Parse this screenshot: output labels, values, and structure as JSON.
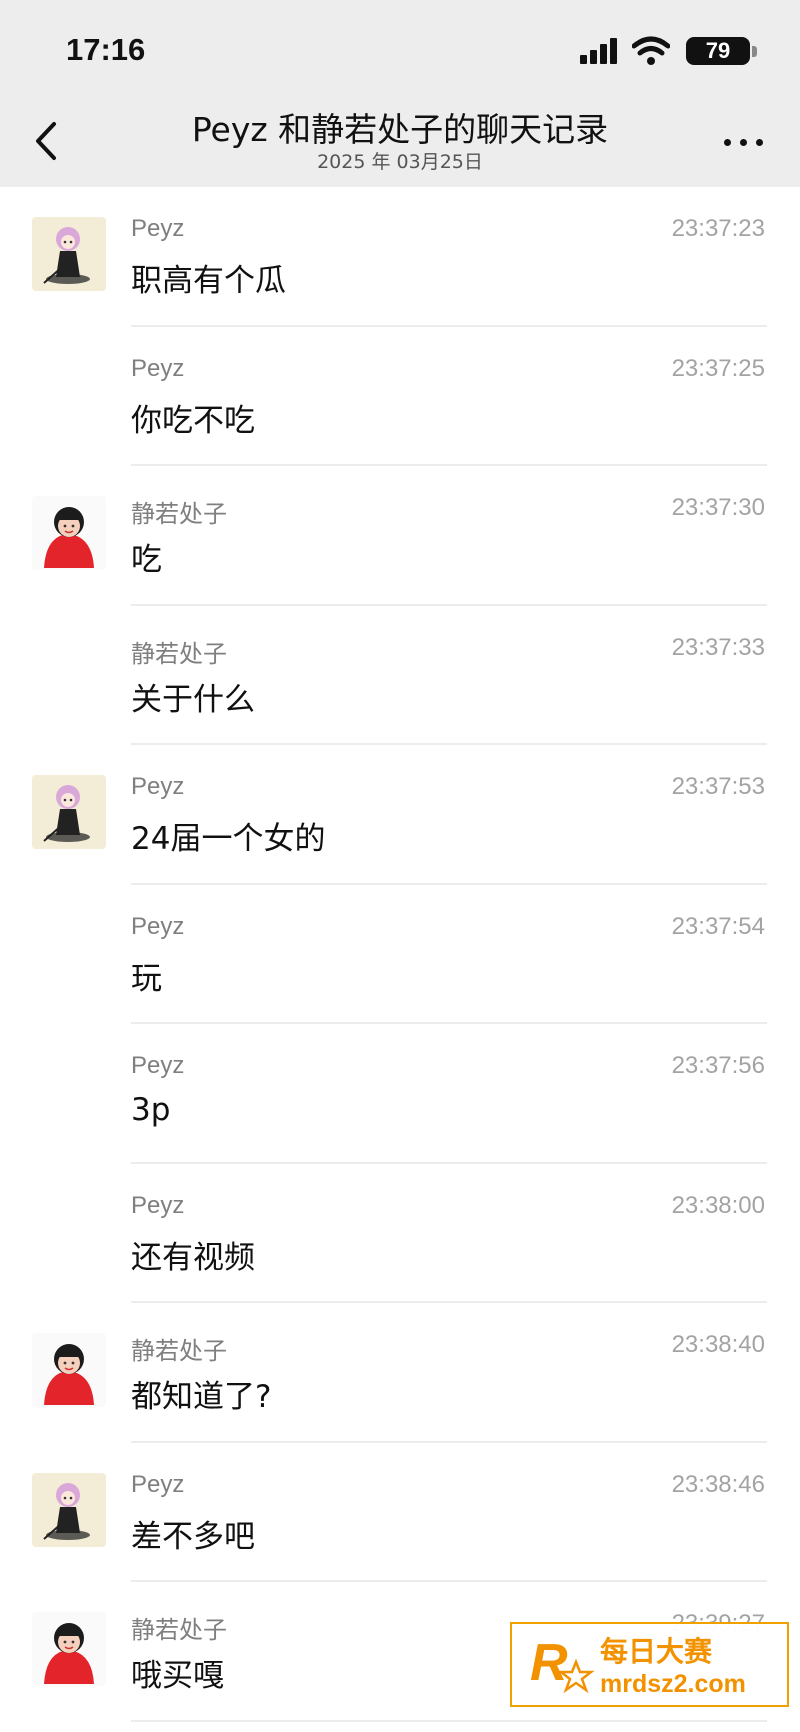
{
  "status_bar": {
    "time": "17:16",
    "battery": "79"
  },
  "nav": {
    "title": "Peyz 和静若处子的聊天记录",
    "subtitle": "2025 年 03月25日"
  },
  "messages": [
    {
      "sender": "Peyz",
      "time": "23:37:23",
      "text": "职高有个瓜",
      "avatar": "peyz-avatar"
    },
    {
      "sender": "Peyz",
      "time": "23:37:25",
      "text": "你吃不吃",
      "avatar": ""
    },
    {
      "sender": "静若处子",
      "time": "23:37:30",
      "text": "吃",
      "avatar": "jingruo-avatar"
    },
    {
      "sender": "静若处子",
      "time": "23:37:33",
      "text": "关于什么",
      "avatar": ""
    },
    {
      "sender": "Peyz",
      "time": "23:37:53",
      "text": "24届一个女的",
      "avatar": "peyz-avatar"
    },
    {
      "sender": "Peyz",
      "time": "23:37:54",
      "text": "玩",
      "avatar": ""
    },
    {
      "sender": "Peyz",
      "time": "23:37:56",
      "text": "3p",
      "avatar": ""
    },
    {
      "sender": "Peyz",
      "time": "23:38:00",
      "text": "还有视频",
      "avatar": ""
    },
    {
      "sender": "静若处子",
      "time": "23:38:40",
      "text": "都知道了?",
      "avatar": "jingruo-avatar"
    },
    {
      "sender": "Peyz",
      "time": "23:38:46",
      "text": "差不多吧",
      "avatar": "peyz-avatar"
    },
    {
      "sender": "静若处子",
      "time": "23:39:27",
      "text": "哦买嘎",
      "avatar": "jingruo-avatar"
    }
  ],
  "watermark": {
    "name": "每日大赛",
    "url": "mrdsz2.com",
    "logo_letter": "R"
  },
  "colors": {
    "background": "#ffffff",
    "header": "#ededed",
    "accent": "#f29200"
  },
  "icons": [
    "back-chevron-icon",
    "more-icon",
    "signal-icon",
    "wifi-icon",
    "battery-icon"
  ]
}
